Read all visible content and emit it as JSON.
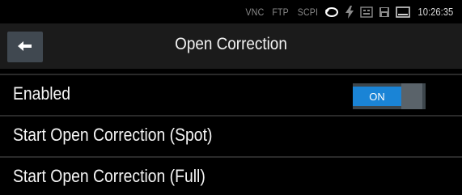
{
  "statusbar": {
    "items": [
      "VNC",
      "FTP",
      "SCPI"
    ],
    "time": "10:26:35",
    "icons": [
      "sync-icon",
      "bolt-icon",
      "lan-icon",
      "save-icon",
      "screen-icon"
    ]
  },
  "titlebar": {
    "title": "Open Correction",
    "back_icon": "arrow-left-icon"
  },
  "rows": [
    {
      "label": "Enabled",
      "toggle_label": "ON",
      "toggle_state": "on"
    },
    {
      "label": "Start Open Correction (Spot)"
    },
    {
      "label": "Start Open Correction (Full)"
    }
  ],
  "colors": {
    "accent": "#1a84d6",
    "titlebar": "#1b1b1b",
    "back_button": "#404850",
    "background": "#000000"
  }
}
